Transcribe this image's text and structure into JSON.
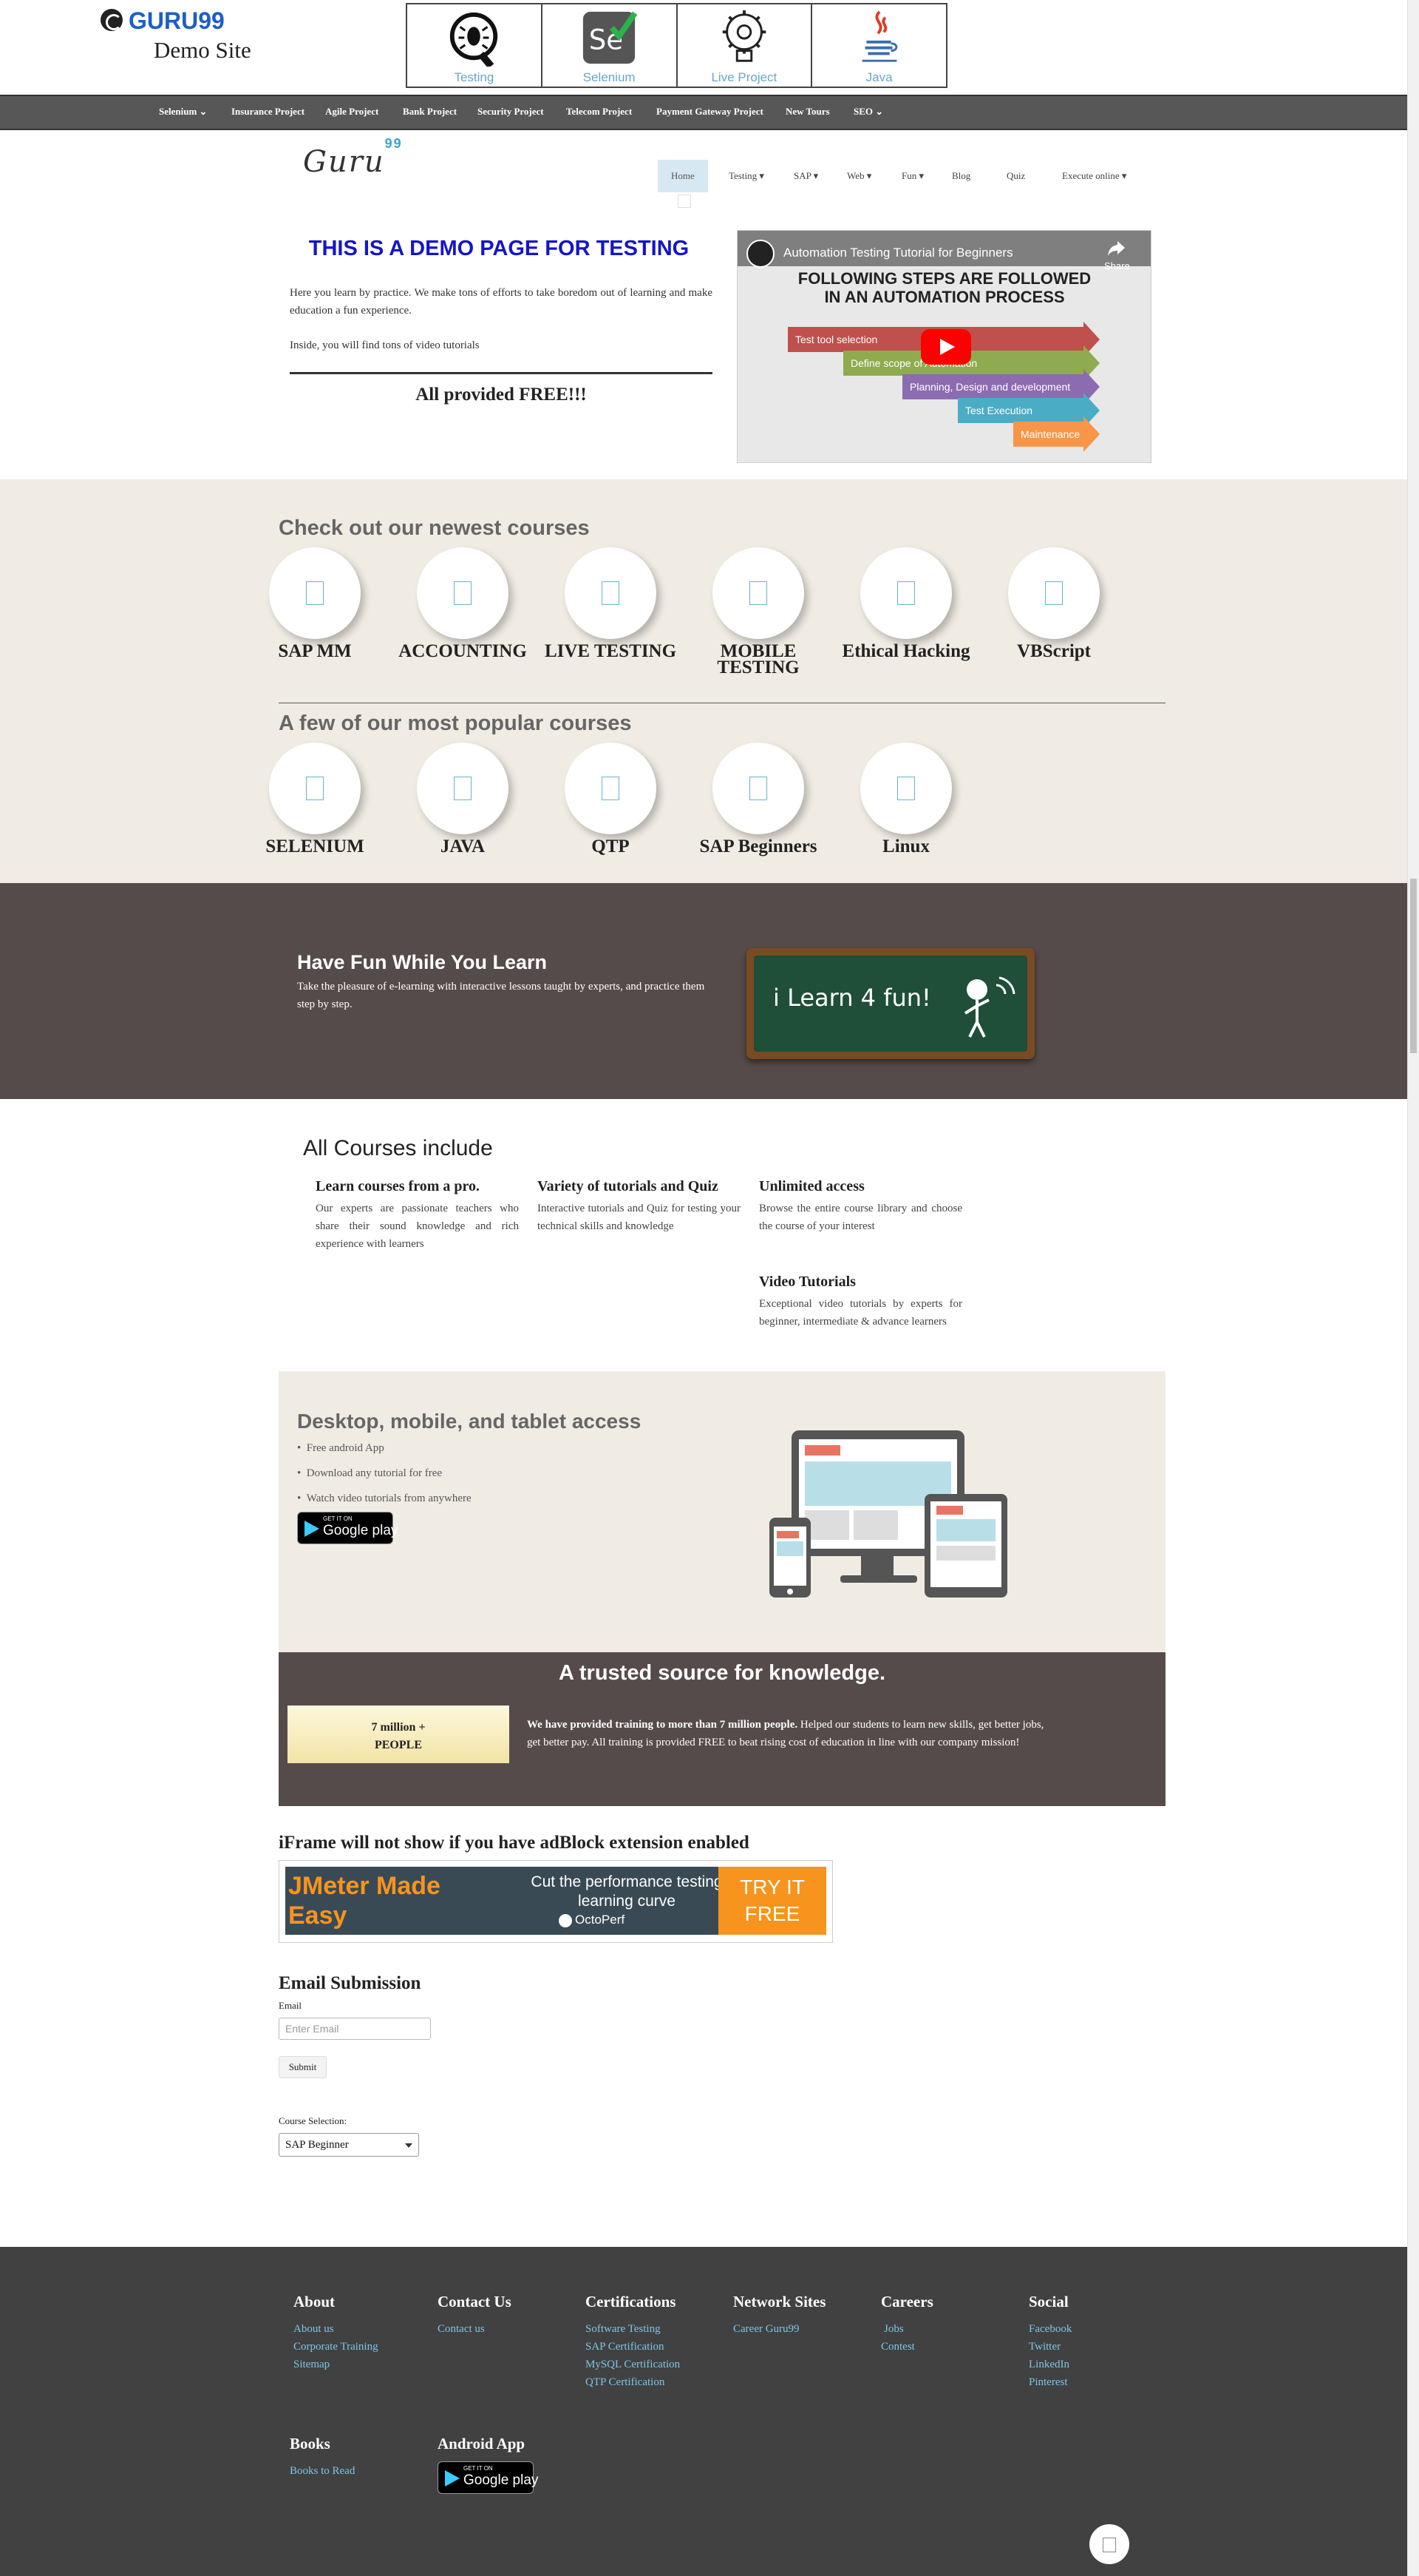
{
  "header": {
    "logo_text": "GURU99",
    "logo_sub": "Demo Site",
    "banner": [
      {
        "label": "Testing",
        "icon": "bug-icon"
      },
      {
        "label": "Selenium",
        "icon": "selenium-icon"
      },
      {
        "label": "Live Project",
        "icon": "bulb-gear-icon"
      },
      {
        "label": "Java",
        "icon": "java-cup-icon"
      }
    ]
  },
  "navbar": {
    "items": [
      "Selenium",
      "Insurance Project",
      "Agile Project",
      "Bank Project",
      "Security Project",
      "Telecom Project",
      "Payment Gateway Project",
      "New Tours",
      "SEO"
    ]
  },
  "second_nav": {
    "logo": "Guru",
    "logo_sup": "99",
    "items": [
      "Home",
      "Testing",
      "SAP",
      "Web",
      "Fun",
      "Blog",
      "Quiz",
      "Execute online"
    ]
  },
  "hero": {
    "title": "THIS IS A DEMO PAGE FOR TESTING",
    "p1": "Here you learn by practice. We make tons of efforts to take boredom out of learning and make education a fun experience.",
    "p2": "Inside, you will find tons of video tutorials",
    "free": "All provided FREE!!!"
  },
  "video": {
    "title": "Automation Testing Tutorial for Beginners",
    "share": "Share",
    "heading_line1": "FOLLOWING STEPS ARE FOLLOWED",
    "heading_line2": "IN AN AUTOMATION PROCESS",
    "steps": [
      "Test tool selection",
      "Define scope of Automation",
      "Planning, Design and development",
      "Test Execution",
      "Maintenance"
    ]
  },
  "newest": {
    "title": "Check out our newest courses",
    "items": [
      "SAP MM",
      "ACCOUNTING",
      "LIVE TESTING",
      "MOBILE TESTING",
      "Ethical Hacking",
      "VBScript"
    ]
  },
  "popular": {
    "title": "A few of our most popular courses",
    "items": [
      "SELENIUM",
      "JAVA",
      "QTP",
      "SAP Beginners",
      "Linux"
    ]
  },
  "fun": {
    "title": "Have Fun While You Learn",
    "text": "Take the pleasure of e-learning with interactive lessons taught by experts, and practice them step by step.",
    "board": "i Learn 4 fun!"
  },
  "all_courses": {
    "title": "All Courses include",
    "features": [
      {
        "title": "Learn courses from a pro.",
        "text": "Our experts are passionate teachers who share their sound knowledge and rich experience with learners"
      },
      {
        "title": "Variety of tutorials and Quiz",
        "text": "Interactive tutorials and Quiz for testing your technical skills and knowledge"
      },
      {
        "title": "Unlimited access",
        "text": "Browse the entire course library and choose the course of your interest"
      },
      {
        "title": "Video Tutorials",
        "text": "Exceptional video tutorials by experts for beginner, intermediate & advance learners"
      }
    ]
  },
  "devices": {
    "title": "Desktop, mobile, and tablet access",
    "items": [
      "Free android App",
      "Download any tutorial for free",
      "Watch video tutorials from anywhere"
    ],
    "gplay_small": "GET IT ON",
    "gplay_big": "Google play"
  },
  "trust": {
    "title": "A trusted source for knowledge.",
    "box_line1": "7 million +",
    "box_line2": "PEOPLE",
    "bold": "We have provided training to more than 7 million people.",
    "text": " Helped our students to learn new skills, get better jobs, get better pay. All training is provided FREE to beat rising cost of education in line with our company mission!"
  },
  "iframe": {
    "title": "iFrame will not show if you have adBlock extension enabled",
    "ad_left_1": "JMeter Made",
    "ad_left_2": "Easy",
    "ad_mid": "Cut the performance testing learning curve",
    "ad_brand": "OctoPerf",
    "ad_cta_1": "TRY IT",
    "ad_cta_2": "FREE"
  },
  "email_form": {
    "title": "Email Submission",
    "label": "Email",
    "placeholder": "Enter Email",
    "submit": "Submit",
    "course_label": "Course Selection:",
    "course_value": "SAP Beginner"
  },
  "footer": {
    "cols": [
      {
        "title": "About",
        "links": [
          "About us",
          "Corporate Training",
          "Sitemap"
        ]
      },
      {
        "title": "Contact Us",
        "links": [
          "Contact us"
        ]
      },
      {
        "title": "Certifications",
        "links": [
          "Software Testing",
          "SAP Certification",
          "MySQL Certification",
          "QTP Certification"
        ]
      },
      {
        "title": "Network Sites",
        "links": [
          "Career Guru99"
        ]
      },
      {
        "title": "Careers",
        "links": [
          "Jobs",
          "Contest"
        ]
      },
      {
        "title": "Social",
        "links": [
          "Facebook",
          "Twitter",
          "LinkedIn",
          "Pinterest"
        ]
      }
    ],
    "books_title": "Books",
    "books_link": "Books to Read",
    "android_title": "Android App"
  },
  "colors": {
    "navbar": "#575757",
    "brown": "#564b4b",
    "beige": "#f0ece4",
    "footer": "#414141",
    "link": "#7dc6e8"
  }
}
